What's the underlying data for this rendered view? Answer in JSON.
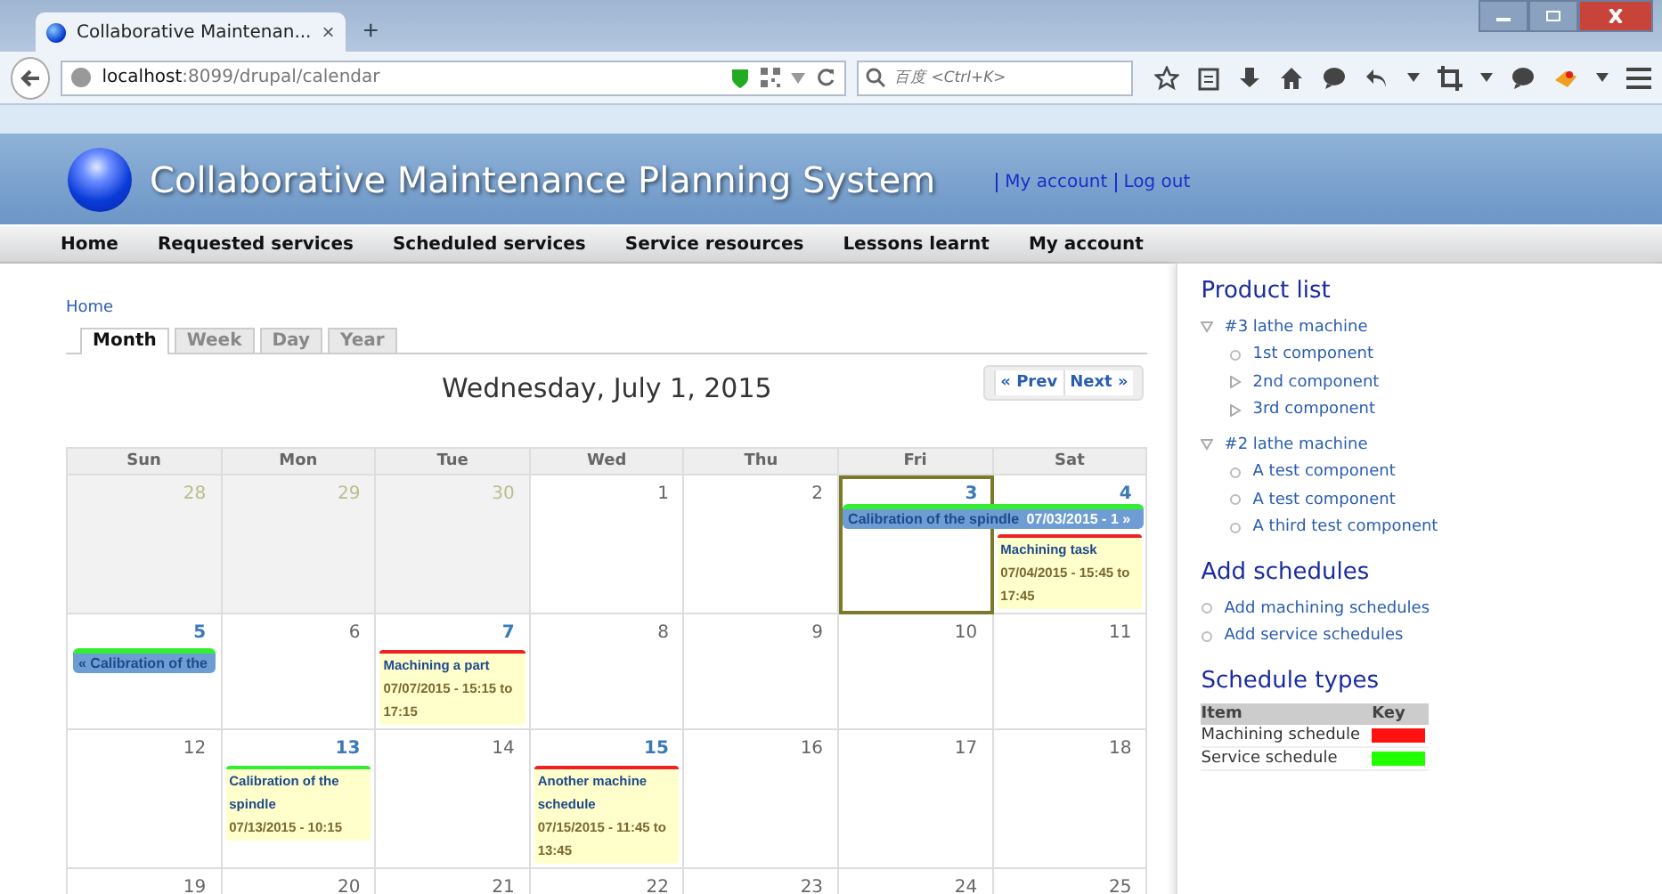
{
  "browser": {
    "tab": {
      "title": "Collaborative Maintenan...",
      "close": "×"
    },
    "new_tab": "+",
    "url": "**localhost**:8099/drupal/calendar",
    "search": {
      "placeholder": "百度 <Ctrl+K>"
    }
  },
  "site": {
    "title": "Collaborative Maintenance Planning System",
    "user_links": [
      "My account",
      "Log out"
    ]
  },
  "nav": [
    "Home",
    "Requested services",
    "Scheduled services",
    "Service resources",
    "Lessons learnt",
    "My account"
  ],
  "breadcrumb": "Home",
  "view_tabs": [
    {
      "label": "Month",
      "selected": true
    },
    {
      "label": "Week",
      "selected": false
    },
    {
      "label": "Day",
      "selected": false
    },
    {
      "label": "Year",
      "selected": false
    }
  ],
  "calendar": {
    "title": "Wednesday, July 1, 2015",
    "prev": "« Prev",
    "next": "Next »",
    "weekdays": [
      "Sun",
      "Mon",
      "Tue",
      "Wed",
      "Thu",
      "Fri",
      "Sat"
    ],
    "weeks": [
      [
        {
          "day": "28",
          "other_month": true,
          "today": false
        },
        {
          "day": "29",
          "other_month": true,
          "today": false
        },
        {
          "day": "30",
          "other_month": true,
          "today": false
        },
        {
          "day": "1",
          "other_month": false,
          "today": false
        },
        {
          "day": "2",
          "other_month": false,
          "today": false
        },
        {
          "day": "3",
          "other_month": false,
          "today": true,
          "events": [
            {
              "kind": "span-bar",
              "title": "Calibration of the spindle",
              "time": "07/03/2015 - 1 »",
              "color": "#33ee33"
            }
          ]
        },
        {
          "day": "4",
          "other_month": false,
          "today": false,
          "events": [
            {
              "kind": "card",
              "title": "Machining task",
              "time": "07/04/2015 - 15:45 to 17:45",
              "color": "#ee2222"
            }
          ]
        }
      ],
      [
        {
          "day": "5",
          "other_month": false,
          "today": false,
          "events": [
            {
              "kind": "bar",
              "title": "« Calibration of the",
              "color": "#33ee33"
            }
          ]
        },
        {
          "day": "6",
          "other_month": false,
          "today": false
        },
        {
          "day": "7",
          "other_month": false,
          "today": false,
          "events": [
            {
              "kind": "card",
              "title": "Machining a part",
              "time": "07/07/2015 - 15:15 to 17:15",
              "color": "#ee2222"
            }
          ]
        },
        {
          "day": "8",
          "other_month": false,
          "today": false
        },
        {
          "day": "9",
          "other_month": false,
          "today": false
        },
        {
          "day": "10",
          "other_month": false,
          "today": false
        },
        {
          "day": "11",
          "other_month": false,
          "today": false
        }
      ],
      [
        {
          "day": "12",
          "other_month": false,
          "today": false
        },
        {
          "day": "13",
          "other_month": false,
          "today": false,
          "events": [
            {
              "kind": "card",
              "title": "Calibration of the spindle",
              "time": "07/13/2015 - 10:15",
              "color": "#33ee33"
            }
          ]
        },
        {
          "day": "14",
          "other_month": false,
          "today": false
        },
        {
          "day": "15",
          "other_month": false,
          "today": false,
          "events": [
            {
              "kind": "card",
              "title": "Another machine schedule",
              "time": "07/15/2015 - 11:45 to 13:45",
              "color": "#ee2222"
            }
          ]
        },
        {
          "day": "16",
          "other_month": false,
          "today": false
        },
        {
          "day": "17",
          "other_month": false,
          "today": false
        },
        {
          "day": "18",
          "other_month": false,
          "today": false
        }
      ],
      [
        {
          "day": "19",
          "other_month": false,
          "today": false
        },
        {
          "day": "20",
          "other_month": false,
          "today": false
        },
        {
          "day": "21",
          "other_month": false,
          "today": false
        },
        {
          "day": "22",
          "other_month": false,
          "today": false
        },
        {
          "day": "23",
          "other_month": false,
          "today": false
        },
        {
          "day": "24",
          "other_month": false,
          "today": false
        },
        {
          "day": "25",
          "other_month": false,
          "today": false
        }
      ]
    ]
  },
  "sidebar": {
    "product_list": {
      "title": "Product list",
      "items": [
        {
          "label": "#3 lathe machine",
          "expanded": true,
          "children": [
            {
              "label": "1st component"
            },
            {
              "label": "2nd component",
              "expanded": false
            },
            {
              "label": "3rd component",
              "expanded": false
            }
          ]
        },
        {
          "label": "#2 lathe machine",
          "expanded": true,
          "children": [
            {
              "label": "A test component"
            },
            {
              "label": "A test component"
            },
            {
              "label": "A third test component"
            }
          ]
        }
      ]
    },
    "add_schedules": {
      "title": "Add schedules",
      "links": [
        "Add machining schedules",
        "Add service schedules"
      ]
    },
    "schedule_types": {
      "title": "Schedule types",
      "columns": [
        "Item",
        "Key"
      ],
      "rows": [
        {
          "item": "Machining schedule",
          "color": "#ff1111"
        },
        {
          "item": "Service schedule",
          "color": "#22ff00"
        }
      ]
    }
  }
}
